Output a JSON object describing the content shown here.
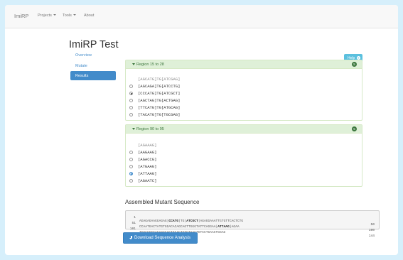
{
  "navbar": {
    "brand": "ImiRP",
    "items": [
      "Projects",
      "Tools",
      "About"
    ]
  },
  "page": {
    "title": "ImiRP Test"
  },
  "sidebar": {
    "items": [
      {
        "label": "Overview",
        "active": false
      },
      {
        "label": "Mutate",
        "active": false
      },
      {
        "label": "Results",
        "active": true
      }
    ]
  },
  "help": {
    "label": "Help"
  },
  "panels": [
    {
      "title": "Region 15 to 28",
      "badge": "5",
      "original": "[AGCATG]TG[ATCGAG]",
      "options": [
        "[AGCAGA]TG[ATCCTG]",
        "[CCCATG]TG[ATCGCT]",
        "[AGCTAG]TG[ACTGAG]",
        "[TTCATG]TG[ATGCAG]",
        "[TACATG]TG[TGCGAG]"
      ],
      "selected_index": 1
    },
    {
      "title": "Region 90 to 95",
      "badge": "5",
      "original": "[AGAAAG]",
      "options": [
        "[AAGAAG]",
        "[AGACCG]",
        "[ATGAAG]",
        "[ATTAAG]",
        "[AGAATC]"
      ],
      "selected_index": 3
    }
  ],
  "assembled": {
    "title": "Assembled Mutant Sequence",
    "lines": [
      {
        "start": "1",
        "end": "50",
        "pre": "AGAGAGAAGGAGAG|",
        "bold": "CCATG",
        "mid": "|TG|",
        "bold2": "ATCGCT",
        "post": "|AGAGGAAATTGTGTTCACTCTG"
      },
      {
        "start": "51",
        "end": "100",
        "pre": "CCAATGACTATGTGGACACAGCAGTTGGGTATTCAGGAA|",
        "bold": "ATTAAG",
        "mid": "|AGAA",
        "bold2": "",
        "post": ""
      },
      {
        "start": "101",
        "end": "144",
        "pre": "TGGCGGTTAGAAGCACTTCACTTTGTAACTGTCCTGAACTGGAG",
        "bold": "",
        "mid": "",
        "bold2": "",
        "post": ""
      }
    ]
  },
  "download": {
    "label": "Download Sequence Analysis"
  },
  "colors": {
    "primary": "#428bca",
    "success_bg": "#dff0d8",
    "success_text": "#3c763d",
    "info": "#5bc0de",
    "outer_bg": "#d6effb"
  }
}
